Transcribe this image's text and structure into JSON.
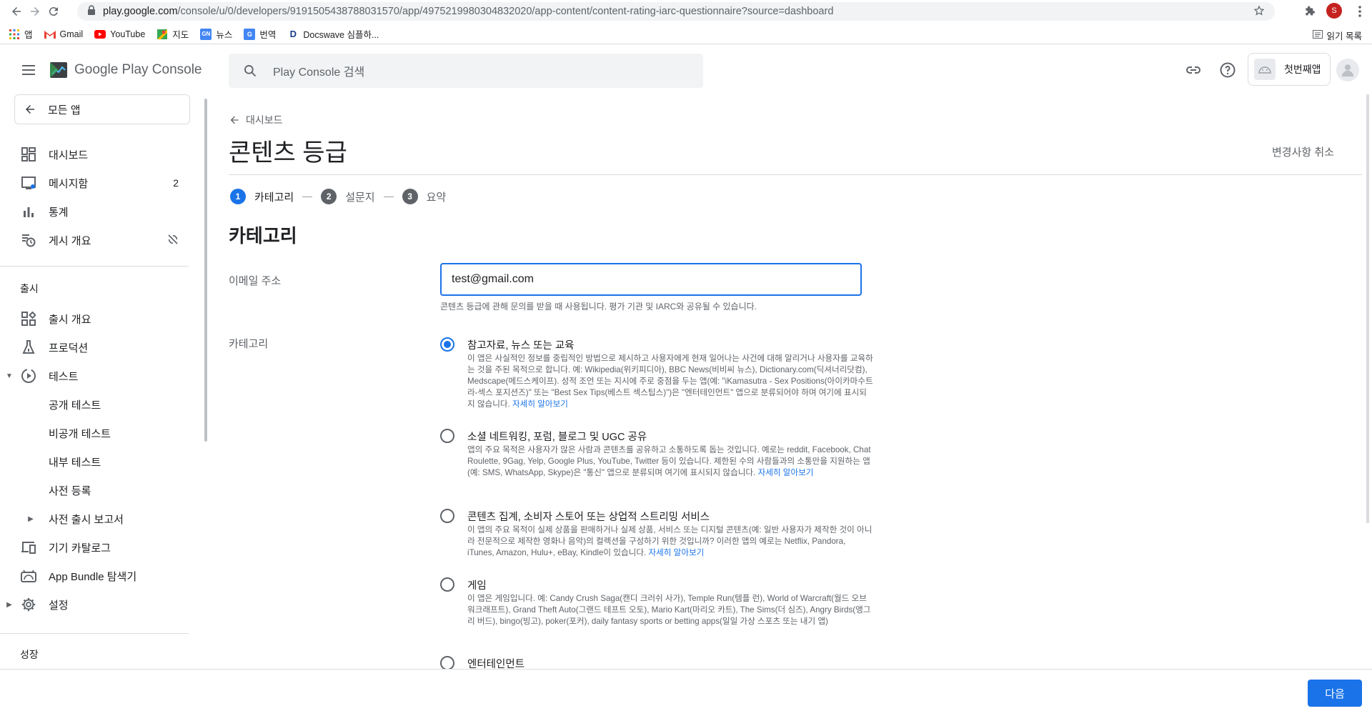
{
  "browser": {
    "url_host": "play.google.com",
    "url_path": "/console/u/0/developers/9191505438788031570/app/4975219980304832020/app-content/content-rating-iarc-questionnaire?source=dashboard",
    "profile_initial": "S",
    "bookmarks": [
      {
        "label": "앱",
        "icon": "apps-grid-icon"
      },
      {
        "label": "Gmail",
        "icon": "gmail-icon"
      },
      {
        "label": "YouTube",
        "icon": "youtube-icon"
      },
      {
        "label": "지도",
        "icon": "maps-icon"
      },
      {
        "label": "뉴스",
        "icon": "news-icon"
      },
      {
        "label": "번역",
        "icon": "translate-icon"
      },
      {
        "label": "Docswave 심플하...",
        "icon": "docswave-icon"
      }
    ],
    "reading_list": "읽기 목록"
  },
  "header": {
    "logo_text": "Google Play Console",
    "search_placeholder": "Play Console 검색",
    "app_name": "첫번째앱"
  },
  "sidebar": {
    "all_apps": "모든 앱",
    "items": [
      {
        "label": "대시보드",
        "icon": "dashboard-icon"
      },
      {
        "label": "메시지함",
        "icon": "inbox-icon",
        "badge": "2"
      },
      {
        "label": "통계",
        "icon": "stats-icon"
      },
      {
        "label": "게시 개요",
        "icon": "publishing-icon"
      }
    ],
    "release_section": "출시",
    "release_items": [
      {
        "label": "출시 개요"
      },
      {
        "label": "프로덕션"
      },
      {
        "label": "테스트"
      },
      {
        "label": "공개 테스트"
      },
      {
        "label": "비공개 테스트"
      },
      {
        "label": "내부 테스트"
      },
      {
        "label": "사전 등록"
      },
      {
        "label": "사전 출시 보고서"
      },
      {
        "label": "기기 카탈로그"
      },
      {
        "label": "App Bundle 탐색기"
      },
      {
        "label": "설정"
      }
    ],
    "growth_section": "성장"
  },
  "main": {
    "back_label": "대시보드",
    "title": "콘텐츠 등급",
    "discard_label": "변경사항 취소",
    "steps": [
      {
        "num": "1",
        "label": "카테고리"
      },
      {
        "num": "2",
        "label": "설문지"
      },
      {
        "num": "3",
        "label": "요약"
      }
    ],
    "section_title": "카테고리",
    "email_label": "이메일 주소",
    "email_value": "test@gmail.com",
    "email_help": "콘텐츠 등급에 관해 문의를 받을 때 사용됩니다. 평가 기관 및 IARC와 공유될 수 있습니다.",
    "category_label": "카테고리",
    "options": [
      {
        "title": "참고자료, 뉴스 또는 교육",
        "desc": "이 앱은 사실적인 정보를 중립적인 방법으로 제시하고 사용자에게 현재 일어나는 사건에 대해 알리거나 사용자를 교육하는 것을 주된 목적으로 합니다. 예: Wikipedia(위키피디아), BBC News(비비씨 뉴스), Dictionary.com(딕셔너리닷컴), Medscape(메드스케이프). 성적 조언 또는 지시에 주로 중점을 두는 앱(예: \"iKamasutra - Sex Positions(아이카마수트라-섹스 포지션즈)\" 또는 \"Best Sex Tips(베스트 섹스팁스)\")은 \"엔터테인먼트\" 앱으로 분류되어야 하며 여기에 표시되지 않습니다.",
        "more": "자세히 알아보기",
        "checked": true
      },
      {
        "title": "소셜 네트워킹, 포럼, 블로그 및 UGC 공유",
        "desc": "앱의 주요 목적은 사용자가 많은 사람과 콘텐츠를 공유하고 소통하도록 돕는 것입니다. 예로는 reddit, Facebook, Chat Roulette, 9Gag, Yelp, Google Plus, YouTube, Twitter 등이 있습니다. 제한된 수의 사람들과의 소통만을 지원하는 앱(예: SMS, WhatsApp, Skype)은 \"통신\" 앱으로 분류되며 여기에 표시되지 않습니다.",
        "more": "자세히 알아보기",
        "checked": false
      },
      {
        "title": "콘텐츠 집계, 소비자 스토어 또는 상업적 스트리밍 서비스",
        "desc": "이 앱의 주요 목적이 실제 상품을 판매하거나 실제 상품, 서비스 또는 디지털 콘텐츠(예: 일반 사용자가 제작한 것이 아니라 전문적으로 제작한 영화나 음악)의 컬렉션을 구성하기 위한 것입니까? 이러한 앱의 예로는 Netflix, Pandora, iTunes, Amazon, Hulu+, eBay, Kindle이 있습니다.",
        "more": "자세히 알아보기",
        "checked": false
      },
      {
        "title": "게임",
        "desc": "이 앱은 게임입니다. 예: Candy Crush Saga(캔디 크러쉬 사가), Temple Run(템플 런), World of Warcraft(월드 오브 워크래프트), Grand Theft Auto(그랜드 테프트 오토), Mario Kart(마리오 카트), The Sims(더 심즈), Angry Birds(앵그리 버드), bingo(빙고), poker(포커), daily fantasy sports or betting apps(일일 가상 스포츠 또는 내기 앱)",
        "more": "",
        "checked": false
      },
      {
        "title": "엔터테인먼트",
        "desc": "",
        "more": "",
        "checked": false
      }
    ],
    "next_label": "다음"
  },
  "colors": {
    "accent": "#1a73e8",
    "text": "#202124",
    "muted": "#5f6368",
    "divider": "#dadce0"
  }
}
